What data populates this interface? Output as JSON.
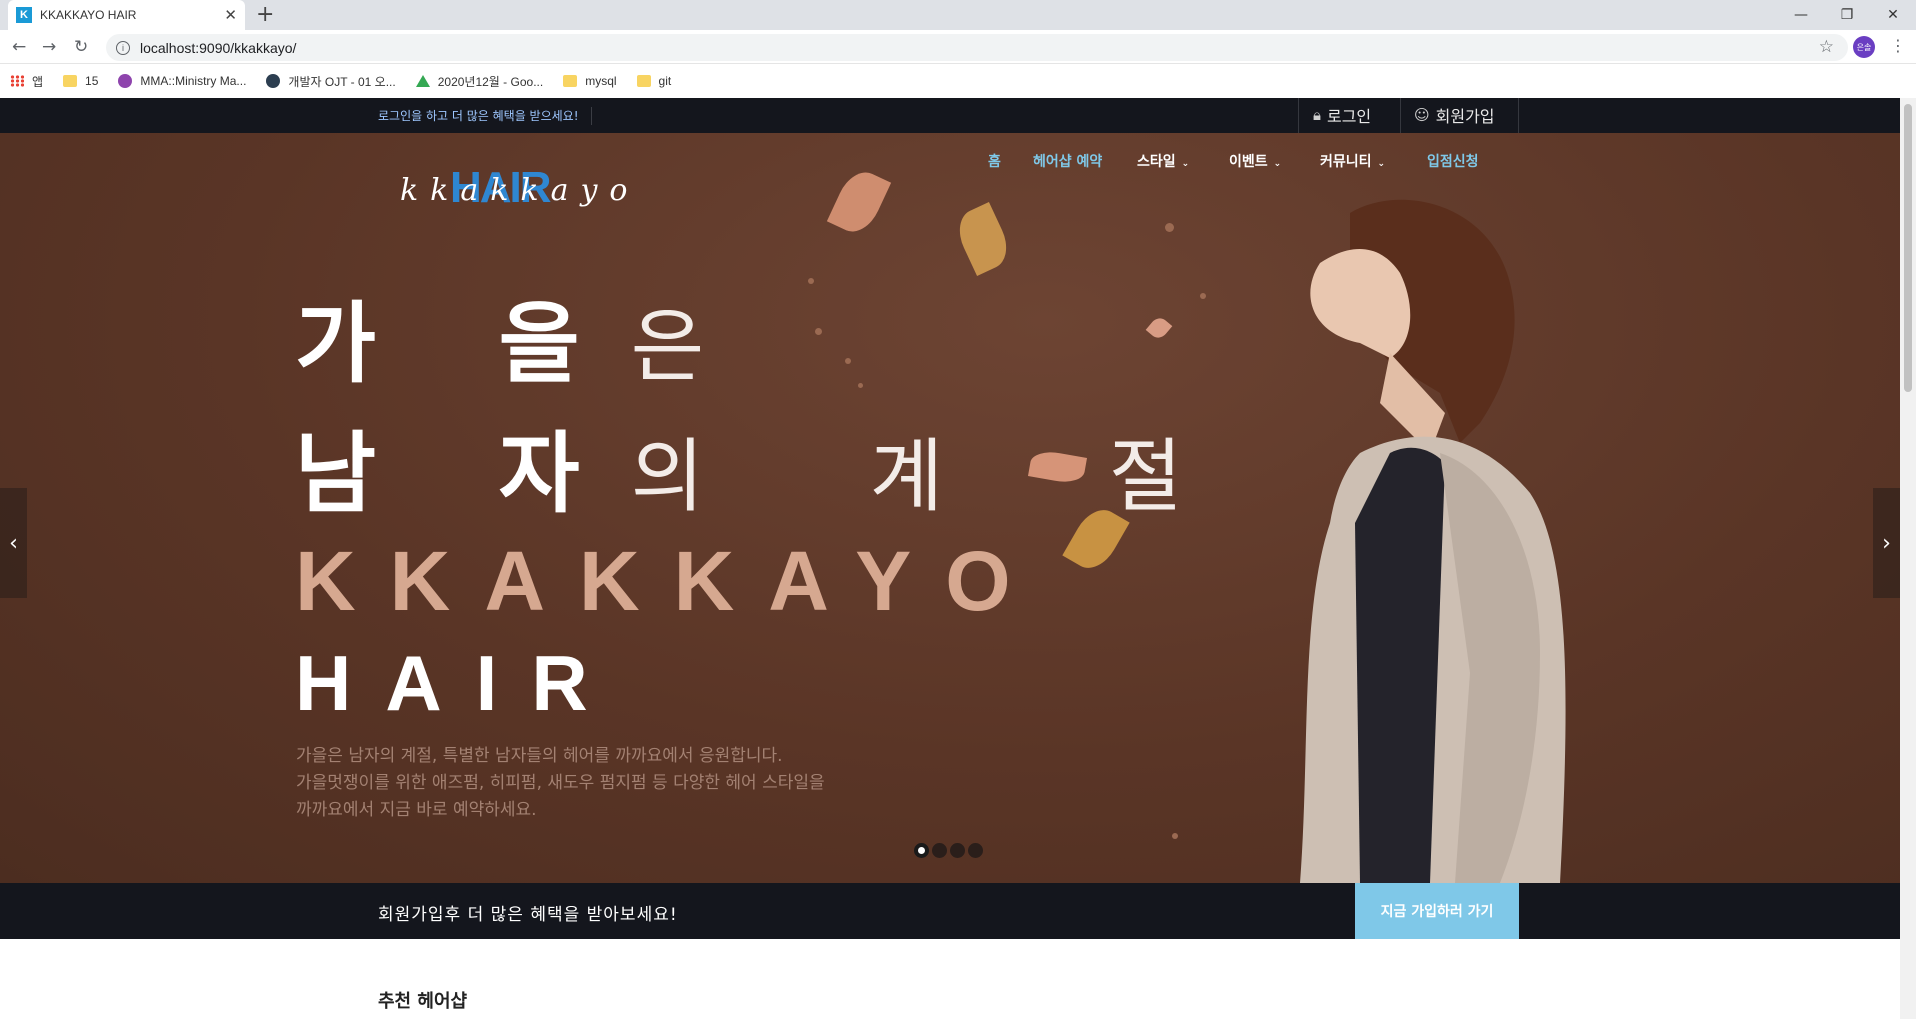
{
  "browser": {
    "tab_title": "KKAKKAYO HAIR",
    "tab_favicon_letter": "K",
    "new_tab": "+",
    "close_tab": "✕",
    "url": "localhost:9090/kkakkayo/",
    "profile_label": "은솔",
    "bookmarks": [
      {
        "label": "앱",
        "icon": "apps-icon"
      },
      {
        "label": "15",
        "icon": "folder-icon"
      },
      {
        "label": "MMA::Ministry Ma...",
        "icon": "power-icon"
      },
      {
        "label": "개발자 OJT - 01 오...",
        "icon": "power-icon"
      },
      {
        "label": "2020년12월 - Goo...",
        "icon": "drive-icon"
      },
      {
        "label": "mysql",
        "icon": "folder-icon"
      },
      {
        "label": "git",
        "icon": "folder-icon"
      }
    ]
  },
  "site": {
    "topbar": {
      "promo": "로그인을 하고 더 많은 혜택을 받으세요!",
      "login": "로그인",
      "signup": "회원가입"
    },
    "logo": {
      "script": "kkakkayo",
      "block": "HAIR"
    },
    "nav": {
      "home": "홈",
      "reserve": "헤어샵 예약",
      "style": "스타일",
      "event": "이벤트",
      "community": "커뮤니티",
      "apply": "입점신청"
    },
    "hero": {
      "line1_bold": "가 을",
      "line1_thin": "은",
      "line2_bold": "남 자",
      "line2_thin": "의 계 절",
      "brand1": "KKAKKAYO",
      "brand2": "HAIR",
      "desc1": "가을은 남자의 계절, 특별한 남자들의 헤어를 까까요에서  응원합니다.",
      "desc2": "가을멋쟁이를 위한 애즈펌, 히피펌, 새도우 펌지펌 등 다양한 헤어 스타일을",
      "desc3": "까까요에서  지금 바로 예약하세요.",
      "slide_count": 4,
      "active_slide": 1
    },
    "joinbar": {
      "message": "회원가입후 더 많은 혜택을 받아보세요!",
      "button": "지금 가입하러 가기"
    },
    "section_title": "추천 헤어샵"
  },
  "colors": {
    "dark_bar": "#14161d",
    "hero_brown": "#5a3526",
    "accent_blue": "#7fc8e8",
    "nav_active": "#7fc8e8",
    "brand_pink": "#d6a890"
  }
}
